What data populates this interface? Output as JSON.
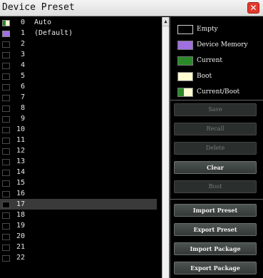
{
  "window": {
    "title": "Device Preset",
    "close_glyph": "✕"
  },
  "presets": [
    {
      "num": "0",
      "name": "Auto",
      "state": "current-boot"
    },
    {
      "num": "1",
      "name": "(Default)",
      "state": "device-memory"
    },
    {
      "num": "2",
      "name": "",
      "state": "empty"
    },
    {
      "num": "3",
      "name": "",
      "state": "empty"
    },
    {
      "num": "4",
      "name": "",
      "state": "empty"
    },
    {
      "num": "5",
      "name": "",
      "state": "empty"
    },
    {
      "num": "6",
      "name": "",
      "state": "empty"
    },
    {
      "num": "7",
      "name": "",
      "state": "empty"
    },
    {
      "num": "8",
      "name": "",
      "state": "empty"
    },
    {
      "num": "9",
      "name": "",
      "state": "empty"
    },
    {
      "num": "10",
      "name": "",
      "state": "empty"
    },
    {
      "num": "11",
      "name": "",
      "state": "empty"
    },
    {
      "num": "12",
      "name": "",
      "state": "empty"
    },
    {
      "num": "13",
      "name": "",
      "state": "empty"
    },
    {
      "num": "14",
      "name": "",
      "state": "empty"
    },
    {
      "num": "15",
      "name": "",
      "state": "empty"
    },
    {
      "num": "16",
      "name": "",
      "state": "empty"
    },
    {
      "num": "17",
      "name": "",
      "state": "empty",
      "selected": true
    },
    {
      "num": "18",
      "name": "",
      "state": "empty"
    },
    {
      "num": "19",
      "name": "",
      "state": "empty"
    },
    {
      "num": "20",
      "name": "",
      "state": "empty"
    },
    {
      "num": "21",
      "name": "",
      "state": "empty"
    },
    {
      "num": "22",
      "name": "",
      "state": "empty"
    }
  ],
  "legend": [
    {
      "label": "Empty",
      "key": "empty"
    },
    {
      "label": "Device Memory",
      "key": "device-memory"
    },
    {
      "label": "Current",
      "key": "current"
    },
    {
      "label": "Boot",
      "key": "boot"
    },
    {
      "label": "Current/Boot",
      "key": "current-boot"
    }
  ],
  "colors": {
    "empty": "#000000",
    "device-memory": "#a070e0",
    "current": "#2a8a2a",
    "boot": "#fffcd0",
    "close": "#e23a2e"
  },
  "buttons": {
    "save": {
      "label": "Save",
      "enabled": false
    },
    "recall": {
      "label": "Recall",
      "enabled": false
    },
    "delete": {
      "label": "Delete",
      "enabled": false
    },
    "clear": {
      "label": "Clear",
      "enabled": true
    },
    "boot": {
      "label": "Boot",
      "enabled": false
    },
    "import_preset": {
      "label": "Import Preset",
      "enabled": true
    },
    "export_preset": {
      "label": "Export Preset",
      "enabled": true
    },
    "import_package": {
      "label": "Import Package",
      "enabled": true
    },
    "export_package": {
      "label": "Export Package",
      "enabled": true
    }
  }
}
